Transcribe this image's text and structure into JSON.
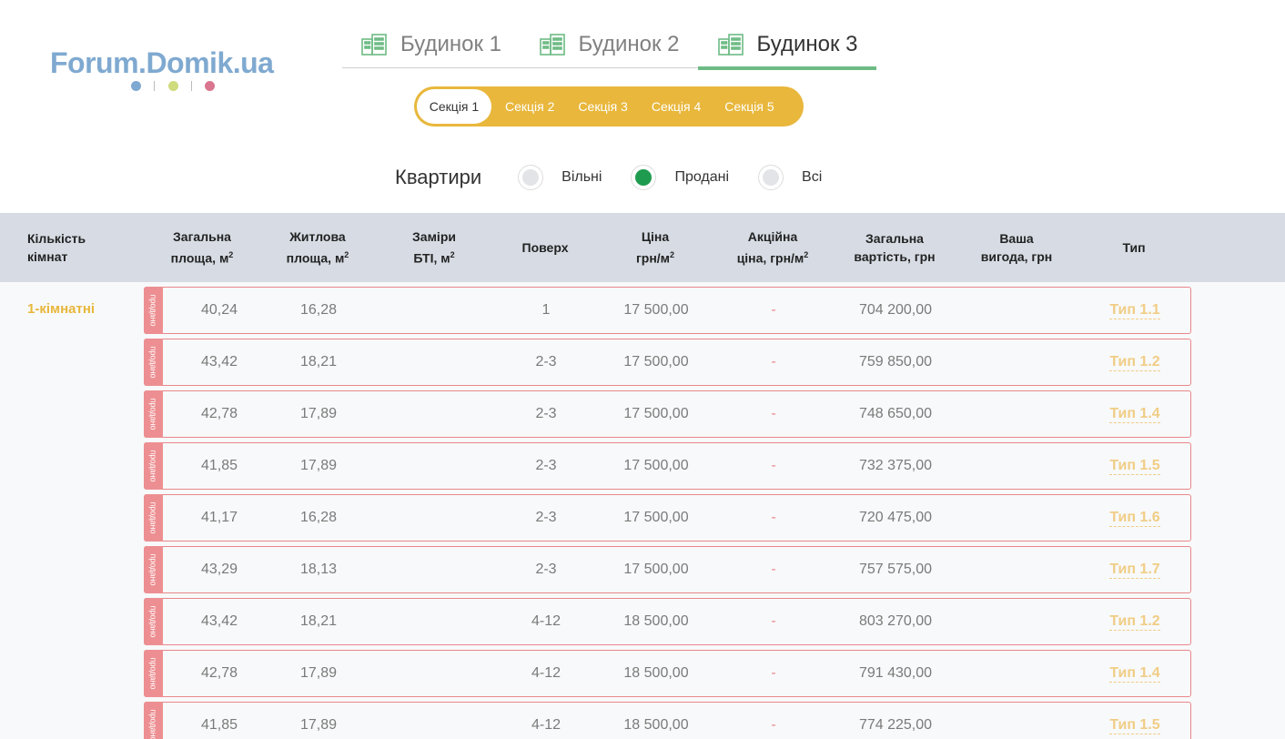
{
  "logo": {
    "text": "Forum.Domik.ua",
    "dots": [
      "#7fa9d0",
      "#cfdb7c",
      "#d9758e"
    ]
  },
  "building_tabs": [
    {
      "label": "Будинок 1",
      "active": false
    },
    {
      "label": "Будинок 2",
      "active": false
    },
    {
      "label": "Будинок 3",
      "active": true
    }
  ],
  "sections": [
    {
      "label": "Секція 1",
      "active": true
    },
    {
      "label": "Секція 2",
      "active": false
    },
    {
      "label": "Секція 3",
      "active": false
    },
    {
      "label": "Секція 4",
      "active": false
    },
    {
      "label": "Секція 5",
      "active": false
    }
  ],
  "filter": {
    "label": "Квартири",
    "options": [
      {
        "label": "Вільні",
        "checked": false
      },
      {
        "label": "Продані",
        "checked": true
      },
      {
        "label": "Всі",
        "checked": false
      }
    ]
  },
  "table": {
    "headers": {
      "rooms": {
        "line1": "Кількість",
        "line2": "кімнат"
      },
      "total_area": {
        "line1": "Загальна",
        "line2": "площа, м",
        "sup": "2"
      },
      "living_area": {
        "line1": "Житлова",
        "line2": "площа, м",
        "sup": "2"
      },
      "bti": {
        "line1": "Заміри",
        "line2": "БТІ, м",
        "sup": "2"
      },
      "floor": {
        "line1": "Поверх"
      },
      "price": {
        "line1": "Ціна",
        "line2": "грн/м",
        "sup": "2"
      },
      "promo": {
        "line1": "Акційна",
        "line2": "ціна, грн/м",
        "sup": "2"
      },
      "total_cost": {
        "line1": "Загальна",
        "line2": "вартість, грн"
      },
      "benefit": {
        "line1": "Ваша",
        "line2": "вигода, грн"
      },
      "type": {
        "line1": "Тип"
      }
    },
    "group_label": "1-кімнатні",
    "sold_label": "продано",
    "rows": [
      {
        "total": "40,24",
        "living": "16,28",
        "bti": "",
        "floor": "1",
        "price": "17 500,00",
        "promo": "-",
        "cost": "704 200,00",
        "benefit": "",
        "type": "Тип 1.1"
      },
      {
        "total": "43,42",
        "living": "18,21",
        "bti": "",
        "floor": "2-3",
        "price": "17 500,00",
        "promo": "-",
        "cost": "759 850,00",
        "benefit": "",
        "type": "Тип 1.2"
      },
      {
        "total": "42,78",
        "living": "17,89",
        "bti": "",
        "floor": "2-3",
        "price": "17 500,00",
        "promo": "-",
        "cost": "748 650,00",
        "benefit": "",
        "type": "Тип 1.4"
      },
      {
        "total": "41,85",
        "living": "17,89",
        "bti": "",
        "floor": "2-3",
        "price": "17 500,00",
        "promo": "-",
        "cost": "732 375,00",
        "benefit": "",
        "type": "Тип 1.5"
      },
      {
        "total": "41,17",
        "living": "16,28",
        "bti": "",
        "floor": "2-3",
        "price": "17 500,00",
        "promo": "-",
        "cost": "720 475,00",
        "benefit": "",
        "type": "Тип 1.6"
      },
      {
        "total": "43,29",
        "living": "18,13",
        "bti": "",
        "floor": "2-3",
        "price": "17 500,00",
        "promo": "-",
        "cost": "757 575,00",
        "benefit": "",
        "type": "Тип 1.7"
      },
      {
        "total": "43,42",
        "living": "18,21",
        "bti": "",
        "floor": "4-12",
        "price": "18 500,00",
        "promo": "-",
        "cost": "803 270,00",
        "benefit": "",
        "type": "Тип 1.2"
      },
      {
        "total": "42,78",
        "living": "17,89",
        "bti": "",
        "floor": "4-12",
        "price": "18 500,00",
        "promo": "-",
        "cost": "791 430,00",
        "benefit": "",
        "type": "Тип 1.4"
      },
      {
        "total": "41,85",
        "living": "17,89",
        "bti": "",
        "floor": "4-12",
        "price": "18 500,00",
        "promo": "-",
        "cost": "774 225,00",
        "benefit": "",
        "type": "Тип 1.5"
      }
    ]
  }
}
